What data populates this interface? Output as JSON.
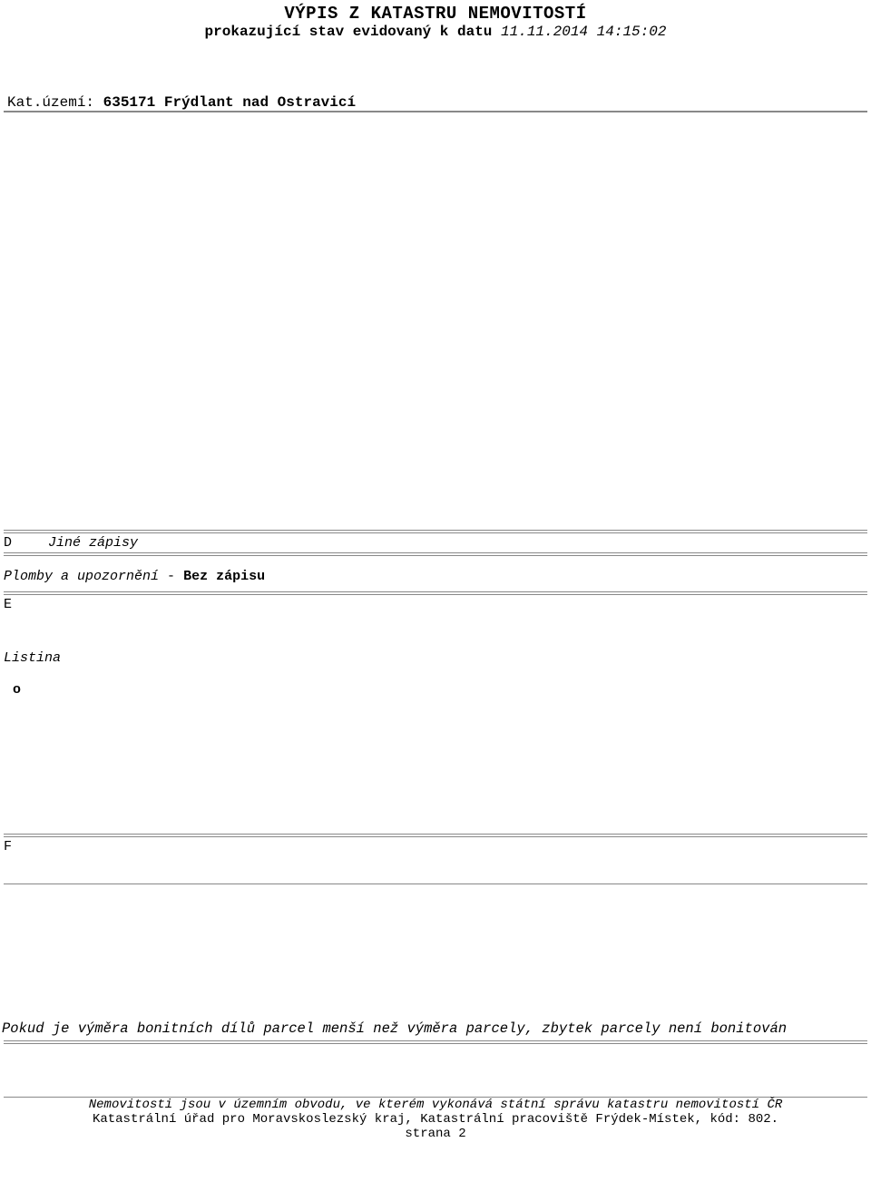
{
  "header": {
    "title": "VÝPIS Z KATASTRU NEMOVITOSTÍ",
    "subtitle_bold": "prokazující stav evidovaný k datu",
    "subtitle_date": "11.11.2014 14:15:02"
  },
  "kat": {
    "label": "Kat.území:",
    "value": "635171 Frýdlant nad Ostravicí"
  },
  "sections": {
    "d_letter": "D",
    "d_label": "Jiné zápisy",
    "plomby_label": "Plomby a upozornění",
    "plomby_dash": "-",
    "plomby_value": "Bez zápisu",
    "e_letter": "E",
    "listina_label": "Listina",
    "bullet": "o",
    "f_letter": "F"
  },
  "note": "Pokud je výměra bonitních dílů parcel menší než výměra parcely, zbytek parcely není bonitován",
  "footer": {
    "line1": "Nemovitosti jsou v územním obvodu, ve kterém vykonává státní správu katastru nemovitostí ČR",
    "line2": "Katastrální úřad pro Moravskoslezský kraj, Katastrální pracoviště Frýdek-Místek, kód: 802.",
    "page": "strana 2"
  }
}
